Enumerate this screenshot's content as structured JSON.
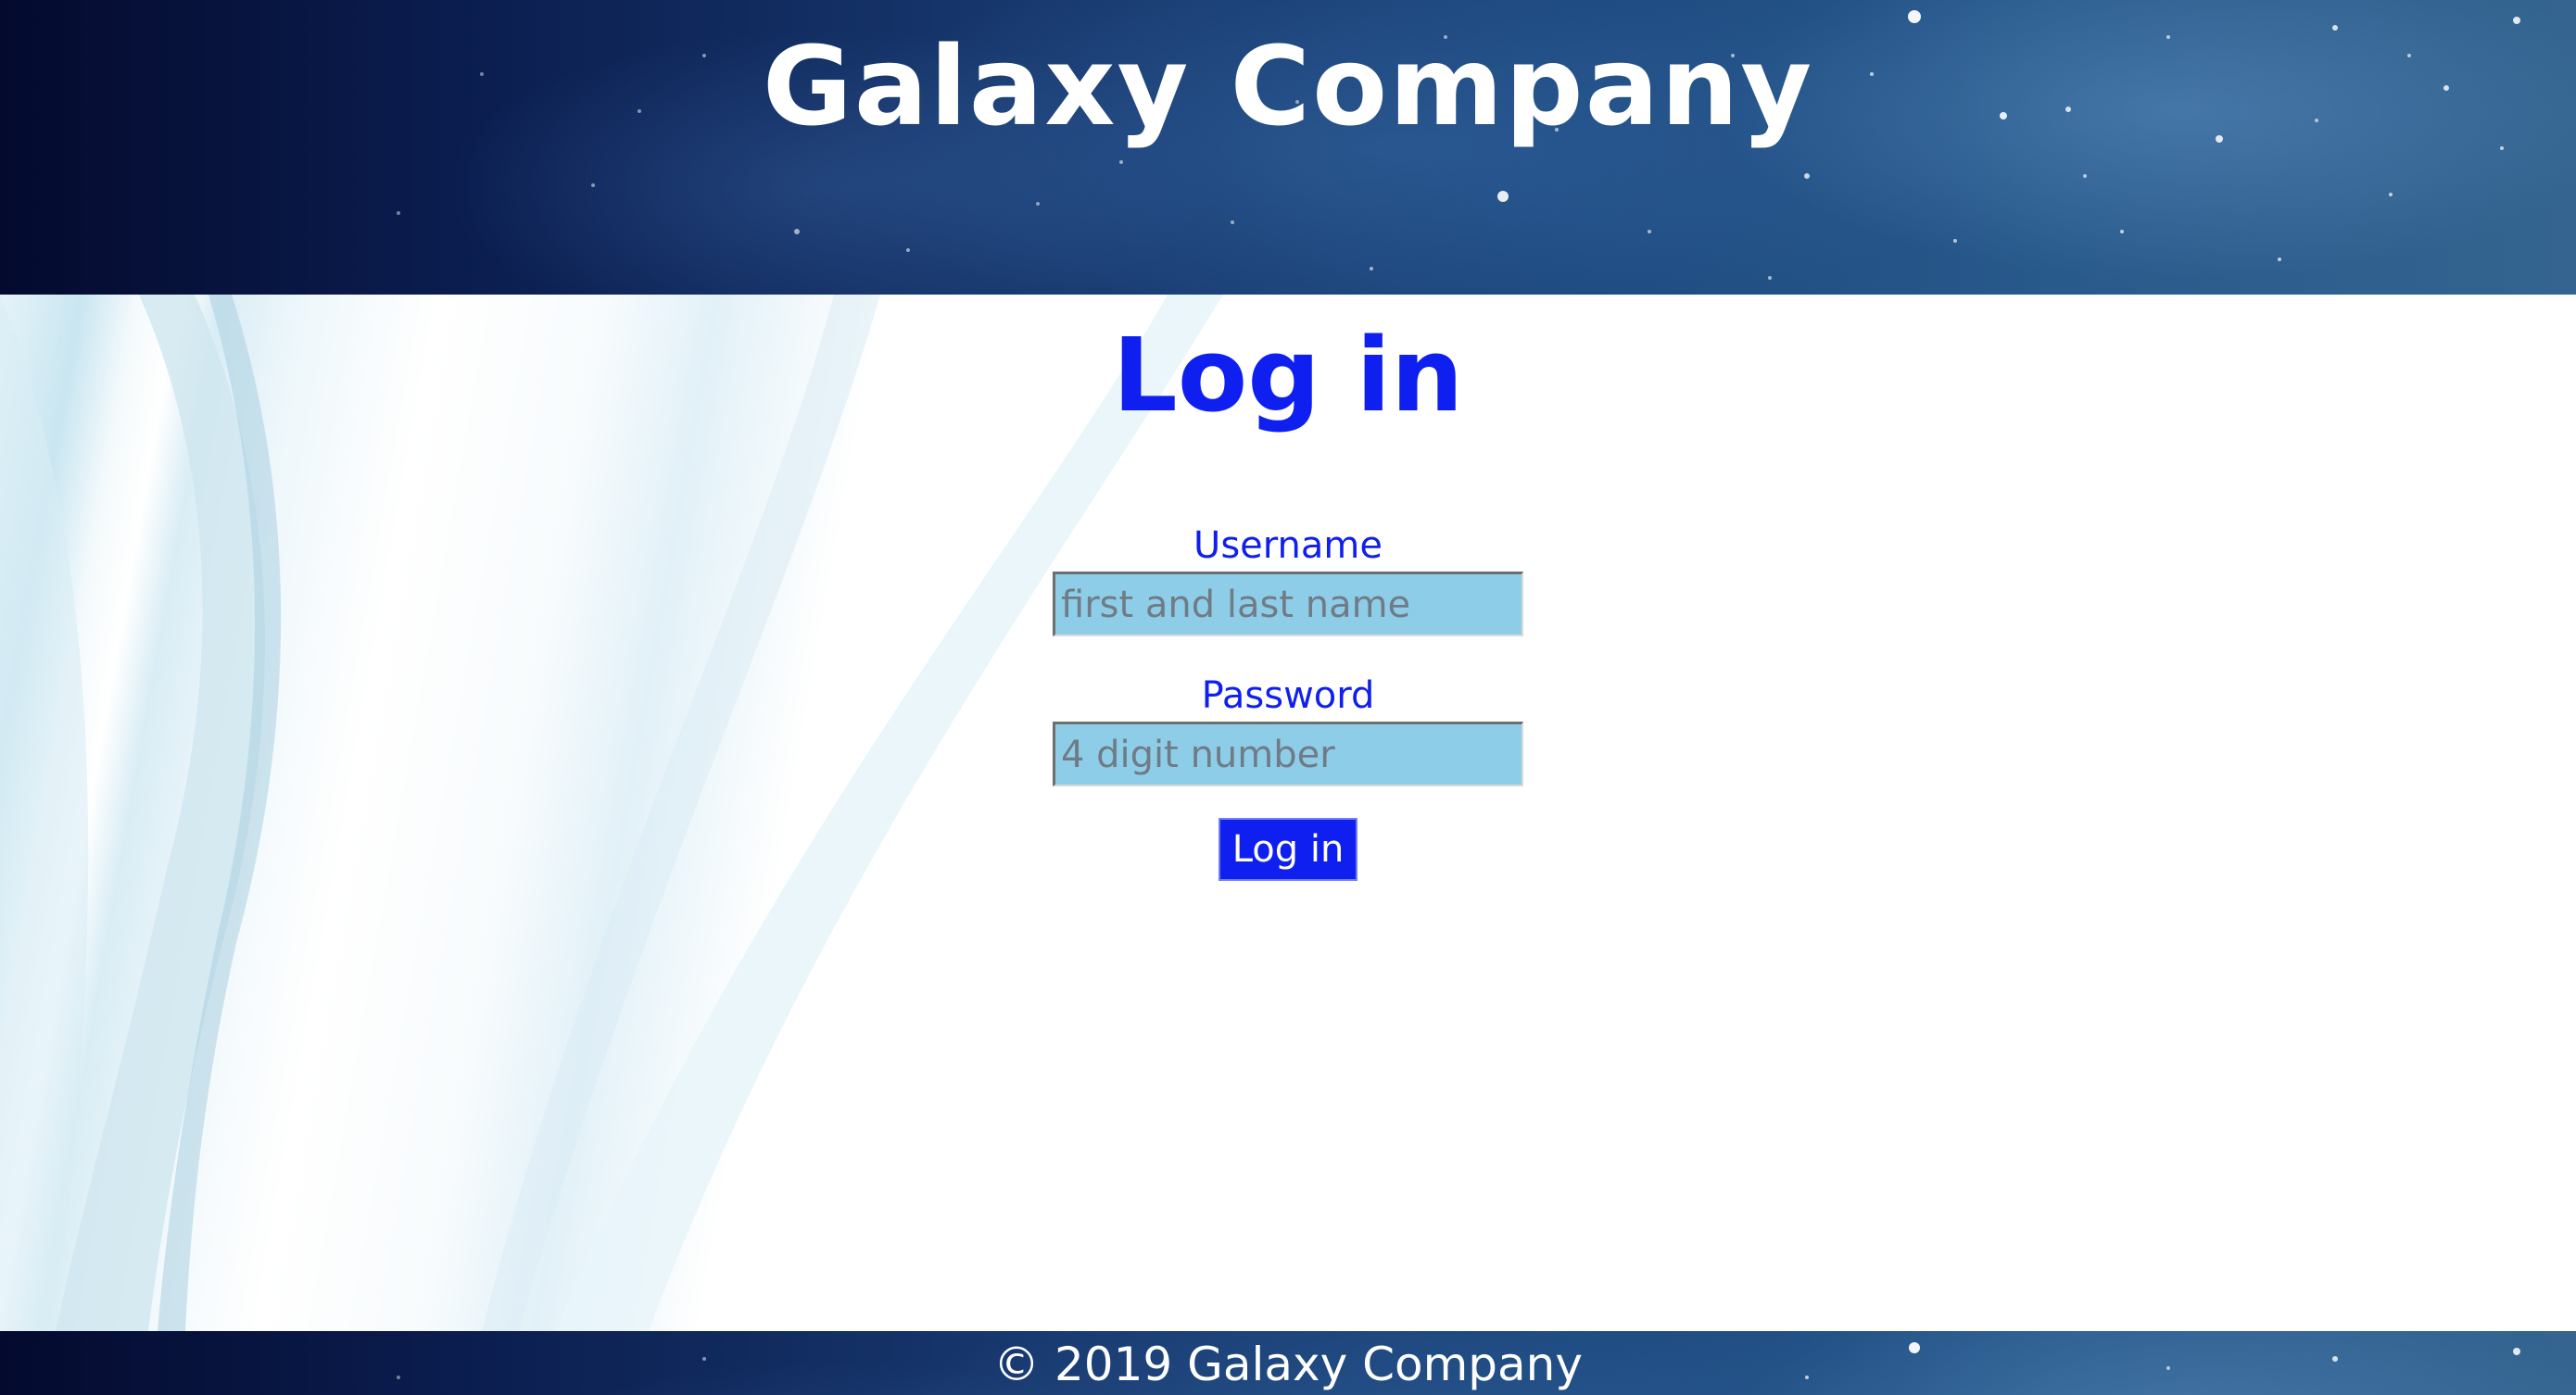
{
  "header": {
    "title": "Galaxy Company"
  },
  "login": {
    "heading": "Log in",
    "username": {
      "label": "Username",
      "placeholder": "first and last name",
      "value": ""
    },
    "password": {
      "label": "Password",
      "placeholder": "4 digit number",
      "value": ""
    },
    "submit_label": "Log in"
  },
  "footer": {
    "copyright": "© 2019 Galaxy Company"
  },
  "colors": {
    "accent": "#0f1ff0",
    "input_background": "#8ecde8",
    "header_background": "#17386e",
    "text_on_dark": "#ffffff"
  }
}
